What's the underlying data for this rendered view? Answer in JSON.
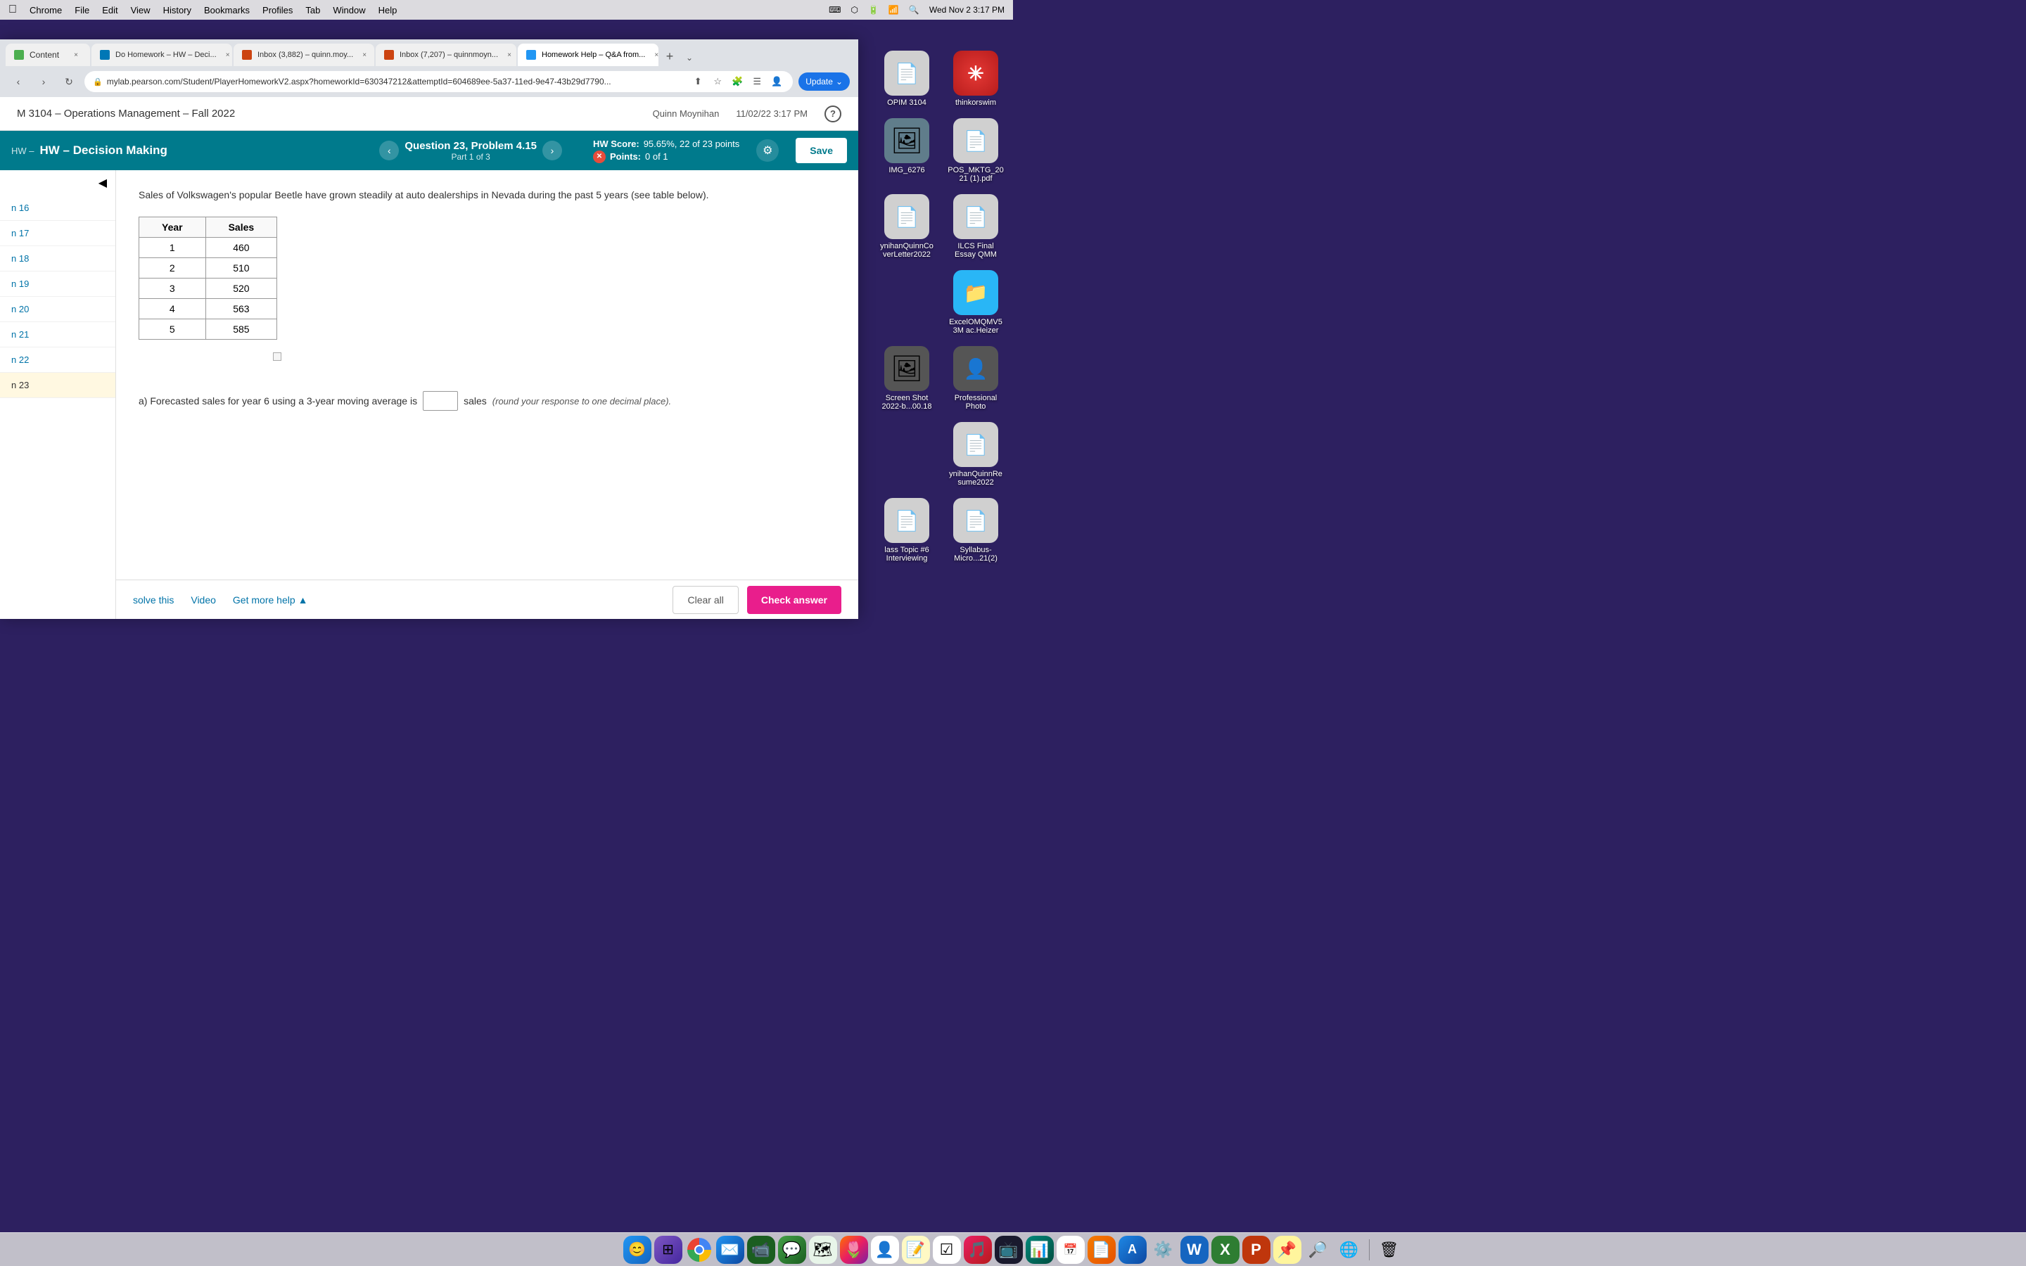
{
  "menubar": {
    "apple": "⌘",
    "items": [
      "Chrome",
      "File",
      "Edit",
      "View",
      "History",
      "Bookmarks",
      "Profiles",
      "Tab",
      "Window",
      "Help"
    ],
    "right_items": [
      "⌨",
      "🔵",
      "🔋",
      "📶",
      "🔍",
      "Wed Nov 2  3:17 PM"
    ]
  },
  "tabs": [
    {
      "id": "tab1",
      "label": "Content",
      "favicon_color": "#4CAF50",
      "active": false
    },
    {
      "id": "tab2",
      "label": "Do Homework – HW – Deci...",
      "favicon_color": "#0077b6",
      "active": false
    },
    {
      "id": "tab3",
      "label": "Inbox (3,882) – quinn.moy...",
      "favicon_color": "#c41",
      "active": false
    },
    {
      "id": "tab4",
      "label": "Inbox (7,207) – quinnmoyn...",
      "favicon_color": "#c41",
      "active": false
    },
    {
      "id": "tab5",
      "label": "Homework Help – Q&A from...",
      "favicon_color": "#2196F3",
      "active": true
    }
  ],
  "address_bar": {
    "url": "mylab.pearson.com/Student/PlayerHomeworkV2.aspx?homeworkId=630347212&attemptId=604689ee-5a37-11ed-9e47-43b29d7790...",
    "update_label": "Update"
  },
  "pearson_header": {
    "title": "M 3104 – Operations Management – Fall 2022",
    "user": "Quinn Moynihan",
    "date": "11/02/22  3:17 PM",
    "help_label": "?"
  },
  "hw_bar": {
    "hw_prefix": "HW –",
    "hw_title": "HW – Decision Making",
    "question_title": "Question 23, Problem 4.15",
    "question_part": "Part 1 of 3",
    "score_label": "HW Score:",
    "score_value": "95.65%, 22 of 23 points",
    "points_label": "Points:",
    "points_value": "0 of 1",
    "save_label": "Save"
  },
  "sidebar": {
    "collapse_icon": "◀",
    "items": [
      {
        "id": "n16",
        "label": "n 16"
      },
      {
        "id": "n17",
        "label": "n 17"
      },
      {
        "id": "n18",
        "label": "n 18"
      },
      {
        "id": "n19",
        "label": "n 19"
      },
      {
        "id": "n20",
        "label": "n 20"
      },
      {
        "id": "n21",
        "label": "n 21"
      },
      {
        "id": "n22",
        "label": "n 22"
      },
      {
        "id": "n23",
        "label": "n 23",
        "active": true
      }
    ]
  },
  "question": {
    "text": "Sales of Volkswagen's popular Beetle have grown steadily at auto dealerships in Nevada during the past 5 years (see table below).",
    "table": {
      "headers": [
        "Year",
        "Sales"
      ],
      "rows": [
        [
          "1",
          "460"
        ],
        [
          "2",
          "510"
        ],
        [
          "3",
          "520"
        ],
        [
          "4",
          "563"
        ],
        [
          "5",
          "585"
        ]
      ]
    },
    "part_a_prefix": "a) Forecasted sales for year 6 using a 3-year moving average is",
    "part_a_suffix": "sales",
    "part_a_note": "(round your response to one decimal place).",
    "answer_placeholder": ""
  },
  "bottom_bar": {
    "solve_label": "solve this",
    "video_label": "Video",
    "more_help_label": "Get more help",
    "more_help_icon": "▲",
    "clear_label": "Clear all",
    "check_label": "Check answer"
  },
  "desktop_icons": [
    {
      "id": "opim3104",
      "label": "OPIM 3104",
      "icon": "📄",
      "color": "#e0e0e0"
    },
    {
      "id": "thinkorswim",
      "label": "thinkorswim",
      "icon": "✳",
      "color": "#ff4444"
    },
    {
      "id": "img6276",
      "label": "IMG_6276",
      "icon": "🖼",
      "color": "#888"
    },
    {
      "id": "pos_mktg",
      "label": "POS_MKTG_2021 (1).pdf",
      "icon": "📄",
      "color": "#e0e0e0"
    },
    {
      "id": "coverletter",
      "label": "ynihanQuinnCo verLetter2022",
      "icon": "📄",
      "color": "#e0e0e0"
    },
    {
      "id": "ilcs_essay",
      "label": "ILCS Final Essay QMM",
      "icon": "📄",
      "color": "#e0e0e0"
    },
    {
      "id": "excel_folder",
      "label": "ExcelOMQMV53M ac.Heizer",
      "icon": "📁",
      "color": "#29b6f6"
    },
    {
      "id": "screenshot",
      "label": "Screen Shot 2022-b...00.18",
      "icon": "🖼",
      "color": "#888"
    },
    {
      "id": "resume",
      "label": "ynihanQuinnRe sume2022",
      "icon": "📄",
      "color": "#e0e0e0"
    },
    {
      "id": "pro_photo",
      "label": "Professional Photo",
      "icon": "👤",
      "color": "#555"
    },
    {
      "id": "class_topic",
      "label": "lass Topic #6 Interviewing",
      "icon": "📄",
      "color": "#e0e0e0"
    },
    {
      "id": "syllabus",
      "label": "Syllabus-Micro...21(2)",
      "icon": "📄",
      "color": "#e0e0e0"
    }
  ],
  "dock": {
    "items": [
      {
        "id": "finder",
        "icon": "🔵",
        "label": "Finder"
      },
      {
        "id": "launchpad",
        "icon": "🟣",
        "label": "Launchpad"
      },
      {
        "id": "chrome",
        "icon": "🔵",
        "label": "Chrome"
      },
      {
        "id": "mail",
        "icon": "✉️",
        "label": "Mail"
      },
      {
        "id": "facetime",
        "icon": "📹",
        "label": "FaceTime"
      },
      {
        "id": "messages",
        "icon": "💬",
        "label": "Messages"
      },
      {
        "id": "maps",
        "icon": "🗺",
        "label": "Maps"
      },
      {
        "id": "photos",
        "icon": "🌷",
        "label": "Photos"
      },
      {
        "id": "contacts",
        "icon": "👤",
        "label": "Contacts"
      },
      {
        "id": "notes",
        "icon": "📝",
        "label": "Notes"
      },
      {
        "id": "reminders",
        "icon": "📋",
        "label": "Reminders"
      },
      {
        "id": "music",
        "icon": "🎵",
        "label": "Music"
      },
      {
        "id": "tv",
        "icon": "📺",
        "label": "TV"
      },
      {
        "id": "numbers",
        "icon": "📊",
        "label": "Numbers"
      },
      {
        "id": "calendar",
        "icon": "📅",
        "label": "Calendar"
      },
      {
        "id": "pages",
        "icon": "📄",
        "label": "Pages"
      },
      {
        "id": "app_store",
        "icon": "🅐",
        "label": "App Store"
      },
      {
        "id": "system_prefs",
        "icon": "⚙️",
        "label": "System Preferences"
      },
      {
        "id": "word",
        "icon": "W",
        "label": "Word"
      },
      {
        "id": "excel",
        "icon": "X",
        "label": "Excel"
      },
      {
        "id": "powerpoint",
        "icon": "P",
        "label": "PowerPoint"
      },
      {
        "id": "sticky_notes",
        "icon": "📌",
        "label": "Sticky Notes"
      },
      {
        "id": "finder2",
        "icon": "🔎",
        "label": "Finder"
      },
      {
        "id": "globe",
        "icon": "🌐",
        "label": "Globe"
      }
    ]
  }
}
